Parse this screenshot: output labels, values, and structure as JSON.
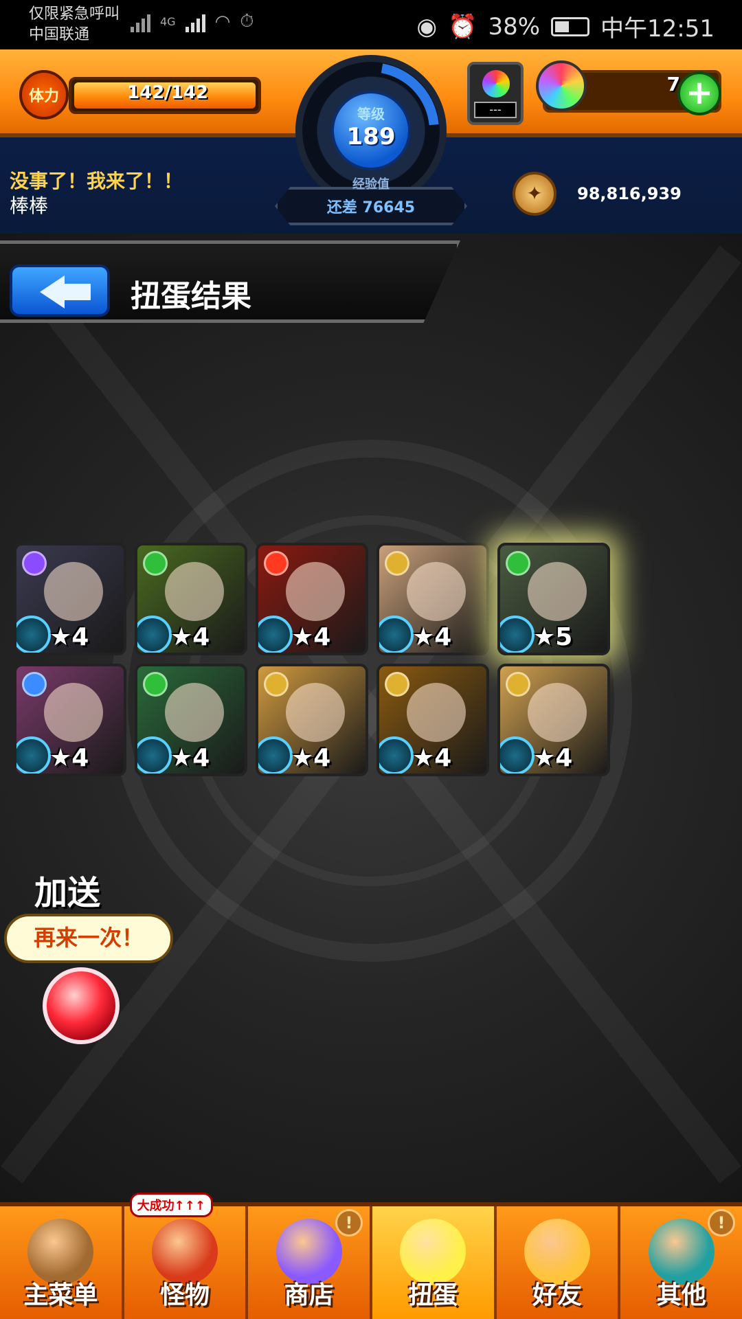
{
  "status_bar": {
    "carrier_line1": "仅限紧急呼叫",
    "carrier_line2": "中国联通",
    "network": "4G",
    "battery": "38%",
    "time": "中午12:51"
  },
  "hud": {
    "stamina_label": "体力",
    "stamina_text": "142/142",
    "stamina_fraction": 1.0,
    "level_label": "等级",
    "level": "189",
    "exp_label": "经验值",
    "exp_remaining": "还差 76645",
    "gauge_value": "---",
    "orb_count": "7",
    "orb_plus": "+",
    "message": "没事了！我来了！！",
    "player_name": "棒棒",
    "coins": "98,816,939"
  },
  "page": {
    "title": "扭蛋结果"
  },
  "results": [
    {
      "stars": "★4",
      "attr_color": "#8a4cff",
      "bg": "#3a3a50"
    },
    {
      "stars": "★4",
      "attr_color": "#2fbf3a",
      "bg": "#4a6a20"
    },
    {
      "stars": "★4",
      "attr_color": "#ff3a20",
      "bg": "#8a1a10"
    },
    {
      "stars": "★4",
      "attr_color": "#e0b030",
      "bg": "#c9a07a"
    },
    {
      "stars": "★5",
      "attr_color": "#2fbf3a",
      "bg": "#4a5a40",
      "highlight": true
    },
    {
      "stars": "★4",
      "attr_color": "#3a8cff",
      "bg": "#7a3a6a"
    },
    {
      "stars": "★4",
      "attr_color": "#2fbf3a",
      "bg": "#2a6a3a"
    },
    {
      "stars": "★4",
      "attr_color": "#e0b030",
      "bg": "#d09a40"
    },
    {
      "stars": "★4",
      "attr_color": "#e0b030",
      "bg": "#8a5a10"
    },
    {
      "stars": "★4",
      "attr_color": "#e0b030",
      "bg": "#d0a050"
    }
  ],
  "bonus": {
    "label": "加送",
    "bubble": "再来一次！"
  },
  "nav": [
    {
      "label": "主菜单",
      "icon": "castle-icon",
      "color": "#a06a30"
    },
    {
      "label": "怪物",
      "icon": "monster-icon",
      "color": "#d83a1a",
      "badge": "大成功↑↑↑"
    },
    {
      "label": "商店",
      "icon": "rainbow-orb-icon",
      "color": "#8a5aff",
      "alert": "!"
    },
    {
      "label": "扭蛋",
      "icon": "egg-icon",
      "color": "#fff04a",
      "active": true
    },
    {
      "label": "好友",
      "icon": "friends-icon",
      "color": "#ffc43a"
    },
    {
      "label": "其他",
      "icon": "other-icon",
      "color": "#20a0a0",
      "alert": "!"
    }
  ]
}
